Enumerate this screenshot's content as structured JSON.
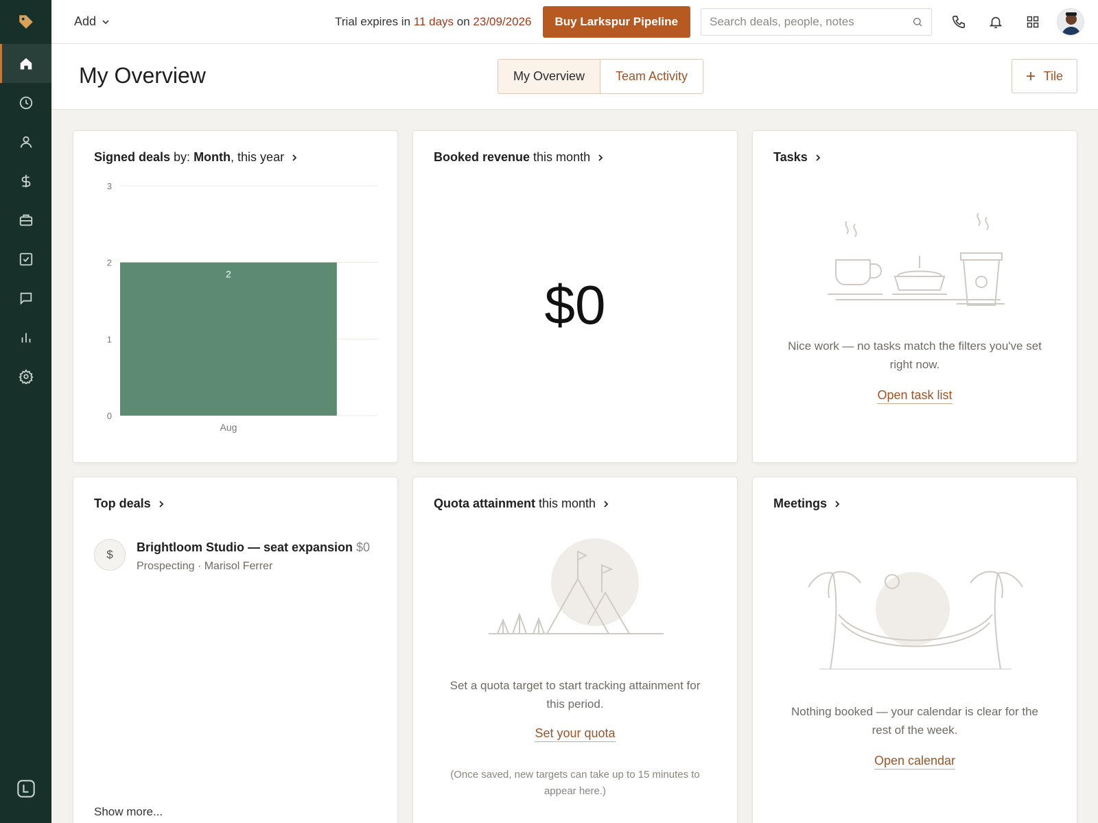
{
  "topbar": {
    "add_label": "Add",
    "trial_prefix": "Trial expires in ",
    "trial_days": "11 days",
    "trial_mid": " on ",
    "trial_date": "23/09/2026",
    "buy_label": "Buy Larkspur Pipeline",
    "search_placeholder": "Search deals, people, notes"
  },
  "header": {
    "title": "My Overview",
    "tabs": [
      {
        "label": "My Overview",
        "active": true
      },
      {
        "label": "Team Activity",
        "active": false
      }
    ],
    "tile_label": "Tile"
  },
  "sidebar": {
    "items": [
      {
        "icon": "home-icon",
        "active": true
      },
      {
        "icon": "clock-icon"
      },
      {
        "icon": "person-icon"
      },
      {
        "icon": "dollar-icon"
      },
      {
        "icon": "briefcase-icon"
      },
      {
        "icon": "checkbox-icon"
      },
      {
        "icon": "chat-icon"
      },
      {
        "icon": "bar-chart-icon"
      },
      {
        "icon": "gear-icon"
      }
    ]
  },
  "cards": {
    "signed_deals": {
      "title_bold": "Signed deals",
      "title_mid": " by: ",
      "title_bold2": "Month",
      "title_tail": ", this year"
    },
    "booked_revenue": {
      "title_bold": "Booked revenue",
      "title_tail": " this month",
      "value": "$0"
    },
    "tasks": {
      "title": "Tasks",
      "empty_text": "Nice work — no tasks match the filters you've set right now.",
      "link": "Open task list"
    },
    "top_deals": {
      "title": "Top deals",
      "deal_name": "Brightloom Studio — seat expansion",
      "deal_amount": "$0",
      "deal_sub": "Prospecting · Marisol Ferrer",
      "deal_icon": "$",
      "show_more": "Show more..."
    },
    "quota": {
      "title_bold": "Quota attainment",
      "title_tail": " this month",
      "empty_text": "Set a quota target to start tracking attainment for this period.",
      "link": "Set your quota",
      "note": "(Once saved, new targets can take up to 15 minutes to appear here.)"
    },
    "meetings": {
      "title": "Meetings",
      "empty_text": "Nothing booked — your calendar is clear for the rest of the week.",
      "link": "Open calendar"
    }
  },
  "chart_data": {
    "type": "bar",
    "categories": [
      "Aug"
    ],
    "values": [
      2
    ],
    "data_labels": [
      "2"
    ],
    "ylim": [
      0,
      3
    ],
    "yticks": [
      0,
      1,
      2,
      3
    ],
    "grid": true,
    "bar_color": "#5d8b72"
  },
  "colors": {
    "accent": "#b65a22",
    "sidebar": "#17302a",
    "link": "#9a5428"
  }
}
